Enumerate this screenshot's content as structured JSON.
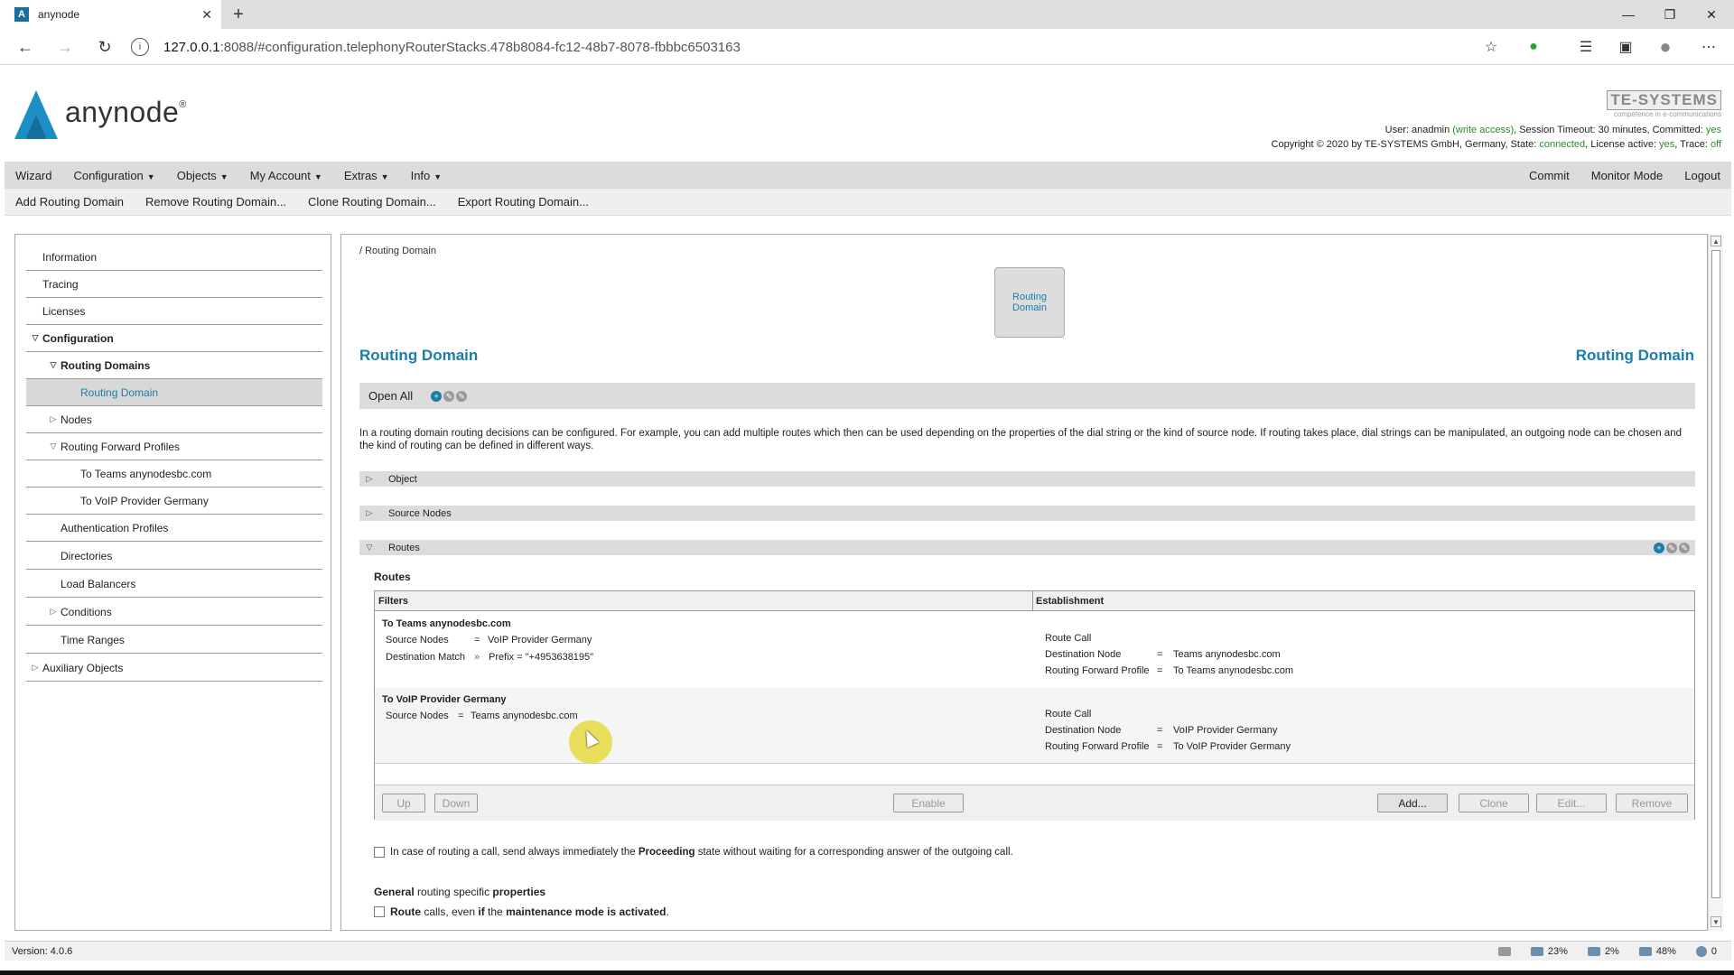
{
  "browser": {
    "tab_title": "anynode",
    "url_host": "127.0.0.1",
    "url_rest": ":8088/#configuration.telephonyRouterStacks.478b8084-fc12-48b7-8078-fbbbc6503163"
  },
  "header": {
    "logo_text": "anynode",
    "logo_reg": "®",
    "te_logo": "TE-SYSTEMS",
    "te_tagline": "competence in e-communications",
    "status": {
      "user_label": "User: ",
      "user": "anadmin",
      "access": " (write access)",
      "timeout": ", Session Timeout: 30 minutes, Committed: ",
      "committed": "yes",
      "copyright": "Copyright © 2020 by TE-SYSTEMS GmbH, Germany, State: ",
      "state": "connected",
      "license_label": ", License active: ",
      "license": "yes",
      "trace_label": ", Trace: ",
      "trace": "off"
    }
  },
  "menu": {
    "items": [
      "Wizard",
      "Configuration",
      "Objects",
      "My Account",
      "Extras",
      "Info"
    ],
    "right": [
      "Commit",
      "Monitor Mode",
      "Logout"
    ]
  },
  "actions": [
    "Add Routing Domain",
    "Remove Routing Domain...",
    "Clone Routing Domain...",
    "Export Routing Domain..."
  ],
  "sidebar": {
    "items": [
      {
        "label": "Information"
      },
      {
        "label": "Tracing"
      },
      {
        "label": "Licenses"
      },
      {
        "label": "Configuration"
      },
      {
        "label": "Routing Domains"
      },
      {
        "label": "Routing Domain"
      },
      {
        "label": "Nodes"
      },
      {
        "label": "Routing Forward Profiles"
      },
      {
        "label": "To Teams anynodesbc.com"
      },
      {
        "label": "To VoIP Provider Germany"
      },
      {
        "label": "Authentication Profiles"
      },
      {
        "label": "Directories"
      },
      {
        "label": "Load Balancers"
      },
      {
        "label": "Conditions"
      },
      {
        "label": "Time Ranges"
      },
      {
        "label": "Auxiliary Objects"
      }
    ]
  },
  "main": {
    "breadcrumb": "/ Routing Domain",
    "icon_label": "Routing Domain",
    "title": "Routing Domain",
    "title_right": "Routing Domain",
    "open_all": "Open All",
    "description": "In a routing domain routing decisions can be configured. For example, you can add multiple routes which then can be used depending on the properties of the dial string or the kind of source node. If routing takes place, dial strings can be manipulated, an outgoing node can be chosen and the kind of routing can be defined in different ways.",
    "sections": [
      "Object",
      "Source Nodes",
      "Routes"
    ],
    "routes_label": "Routes",
    "columns": [
      "Filters",
      "Establishment"
    ],
    "routes": [
      {
        "name": "To Teams anynodesbc.com",
        "filters": [
          {
            "key": "Source Nodes",
            "op": "=",
            "value": "VoIP Provider Germany"
          },
          {
            "key": "Destination Match",
            "op": "»",
            "value": "Prefix = \"+4953638195\""
          }
        ],
        "establishment_title": "Route Call",
        "establishment": [
          {
            "key": "Destination Node",
            "op": "=",
            "value": "Teams anynodesbc.com"
          },
          {
            "key": "Routing Forward Profile",
            "op": "=",
            "value": "To Teams anynodesbc.com"
          }
        ]
      },
      {
        "name": "To VoIP Provider Germany",
        "filters": [
          {
            "key": "Source Nodes",
            "op": "=",
            "value": "Teams anynodesbc.com"
          }
        ],
        "establishment_title": "Route Call",
        "establishment": [
          {
            "key": "Destination Node",
            "op": "=",
            "value": "VoIP Provider Germany"
          },
          {
            "key": "Routing Forward Profile",
            "op": "=",
            "value": "To VoIP Provider Germany"
          }
        ]
      }
    ],
    "buttons": {
      "up": "Up",
      "down": "Down",
      "enable": "Enable",
      "add": "Add...",
      "clone": "Clone",
      "edit": "Edit...",
      "remove": "Remove"
    },
    "proceeding_pre": "In case of routing a call, send always immediately the ",
    "proceeding_bold": "Proceeding",
    "proceeding_post": " state without waiting for a corresponding answer of the outgoing call.",
    "general_b1": "General",
    "general_mid": " routing specific ",
    "general_b2": "properties",
    "maint_b1": "Route",
    "maint_t1": " calls, even ",
    "maint_b2": "if",
    "maint_t2": " the ",
    "maint_b3": "maintenance mode is activated",
    "maint_t3": "."
  },
  "statusbar": {
    "version": "Version: 4.0.6",
    "cpu": "23%",
    "mem": "2%",
    "disk": "48%",
    "info": "0"
  }
}
